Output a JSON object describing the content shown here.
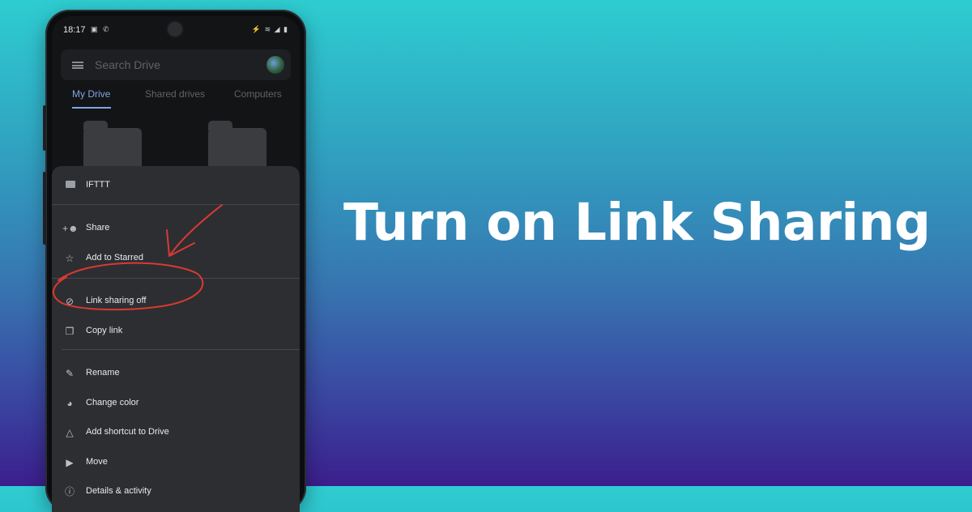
{
  "headline": "Turn on Link Sharing",
  "status": {
    "time": "18:17"
  },
  "search": {
    "placeholder": "Search Drive"
  },
  "tabs": [
    {
      "label": "My Drive",
      "active": true
    },
    {
      "label": "Shared drives",
      "active": false
    },
    {
      "label": "Computers",
      "active": false
    }
  ],
  "sheet": {
    "title": "IFTTT",
    "items": [
      {
        "label": "Share",
        "icon": "add-person-icon"
      },
      {
        "label": "Add to Starred",
        "icon": "star-icon"
      },
      {
        "label": "Link sharing off",
        "icon": "link-off-icon"
      },
      {
        "label": "Copy link",
        "icon": "copy-icon"
      },
      {
        "label": "Rename",
        "icon": "edit-icon"
      },
      {
        "label": "Change color",
        "icon": "palette-icon"
      },
      {
        "label": "Add shortcut to Drive",
        "icon": "drive-shortcut-icon"
      },
      {
        "label": "Move",
        "icon": "move-folder-icon"
      },
      {
        "label": "Details & activity",
        "icon": "info-icon"
      }
    ]
  },
  "colors": {
    "accent": "#7fa6e6",
    "annotation": "#d83a32",
    "background_top": "#2ecdd1",
    "background_bottom": "#3c1e8c"
  }
}
